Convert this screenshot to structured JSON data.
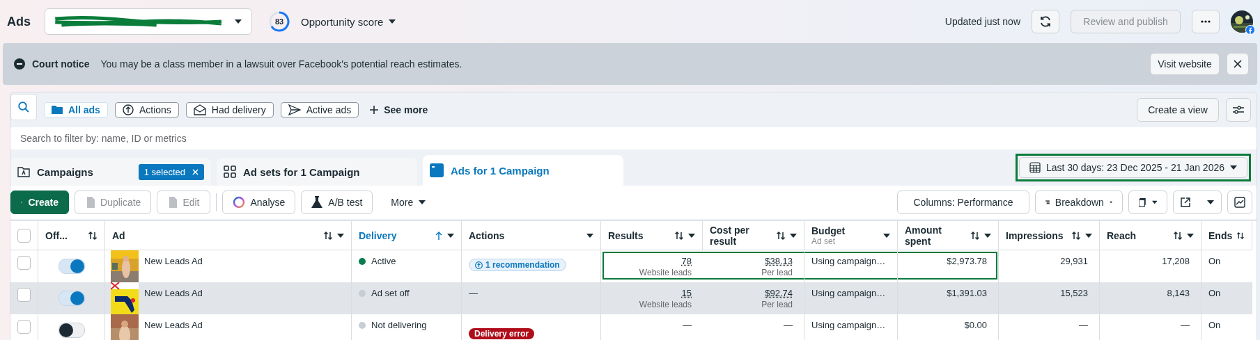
{
  "app": {
    "title": "Ads"
  },
  "opportunity": {
    "score": "83",
    "label": "Opportunity score"
  },
  "header": {
    "status": "Updated just now",
    "publish_button": "Review and publish",
    "publish_disabled": true
  },
  "notice": {
    "title": "Court notice",
    "text": "You may be a class member in a lawsuit over Facebook's potential reach estimates.",
    "button": "Visit website"
  },
  "filters": [
    {
      "label": "All ads",
      "selected": true
    },
    {
      "label": "Actions",
      "selected": false
    },
    {
      "label": "Had delivery",
      "selected": false
    },
    {
      "label": "Active ads",
      "selected": false
    }
  ],
  "see_more": "See more",
  "create_view": "Create a view",
  "search": {
    "placeholder": "Search to filter by: name, ID or metrics"
  },
  "level_tabs": [
    {
      "label": "Campaigns",
      "selected": false,
      "badge": "1 selected"
    },
    {
      "label": "Ad sets for 1 Campaign",
      "selected": false
    },
    {
      "label": "Ads for 1 Campaign",
      "selected": true
    }
  ],
  "date_range": {
    "label": "Last 30 days: 23 Dec 2025 - 21 Jan 2026",
    "highlighted": true
  },
  "toolbar": {
    "actions": [
      {
        "label": "Create",
        "kind": "primary"
      },
      {
        "label": "Duplicate",
        "kind": "disabled"
      },
      {
        "label": "Edit",
        "kind": "disabled"
      },
      {
        "label": "Analyse",
        "kind": "analyse"
      },
      {
        "label": "A/B test",
        "kind": "flask"
      },
      {
        "label": "More",
        "kind": "menu"
      }
    ],
    "columns_button": "Columns: Performance",
    "breakdown_button": "Breakdown"
  },
  "table": {
    "all_checked": false,
    "columns": [
      {
        "label": "Off...",
        "sortable": true,
        "menu": false,
        "sorted": false
      },
      {
        "label": "Ad",
        "sortable": true,
        "menu": true,
        "sorted": false
      },
      {
        "label": "Delivery",
        "sortable": true,
        "menu": true,
        "sorted": true
      },
      {
        "label": "Actions",
        "sortable": false,
        "menu": true,
        "sorted": false
      },
      {
        "label": "Results",
        "sortable": true,
        "menu": true,
        "sorted": false
      },
      {
        "label": "Cost per result",
        "sortable": true,
        "menu": true,
        "sorted": false
      },
      {
        "label": "Budget",
        "sub": "Ad set",
        "sortable": false,
        "menu": true,
        "sorted": false
      },
      {
        "label": "Amount spent",
        "sortable": true,
        "menu": true,
        "sorted": false
      },
      {
        "label": "Impressions",
        "sortable": true,
        "menu": true,
        "sorted": false
      },
      {
        "label": "Reach",
        "sortable": true,
        "menu": true,
        "sorted": false
      },
      {
        "label": "Ends",
        "sortable": true,
        "menu": false,
        "sorted": false
      }
    ],
    "rows": [
      {
        "checked": false,
        "on": true,
        "hovered": false,
        "highlighted": true,
        "name": "New Leads Ad",
        "delivery": "Active",
        "color": "#0a7d50",
        "action": {
          "kind": "recommendation",
          "label": "1 recommendation"
        },
        "results": "78",
        "results_sub": "Website leads",
        "cost": "$38.13",
        "cost_sub": "Per lead",
        "budget": "Using campaign…",
        "amount": "$2,973.78",
        "impressions": "29,931",
        "reach": "17,208",
        "ends": "On"
      },
      {
        "checked": false,
        "on": true,
        "hovered": true,
        "highlighted": false,
        "name": "New Leads Ad",
        "delivery": "Ad set off",
        "color": "#c6cdd5",
        "action": {
          "kind": "none",
          "label": "—"
        },
        "results": "15",
        "results_sub": "Website leads",
        "cost": "$92.74",
        "cost_sub": "Per lead",
        "budget": "Using campaign…",
        "amount": "$1,391.03",
        "impressions": "15,523",
        "reach": "8,143",
        "ends": "On"
      },
      {
        "checked": false,
        "on": false,
        "hovered": false,
        "highlighted": false,
        "name": "New Leads Ad",
        "delivery": "Not delivering",
        "color": "#c6cdd5",
        "action": {
          "kind": "error",
          "label": "Delivery error"
        },
        "results": "—",
        "cost": "—",
        "budget": "Using campaign…",
        "amount": "$0.00",
        "impressions": "—",
        "reach": "—",
        "ends": "On"
      }
    ]
  }
}
